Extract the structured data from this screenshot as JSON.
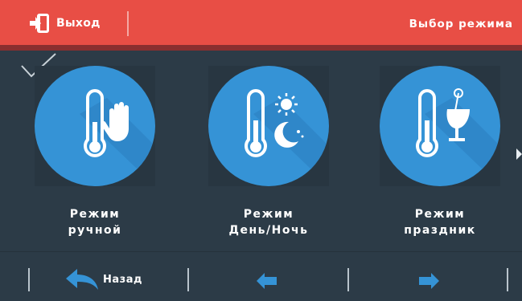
{
  "header": {
    "exit_label": "Выход",
    "title": "Выбор режима"
  },
  "modes": [
    {
      "line1": "Режим",
      "line2": "ручной",
      "icon": "thermometer-hand-icon",
      "selected": true
    },
    {
      "line1": "Режим",
      "line2": "День/Ночь",
      "icon": "thermometer-day-night-icon",
      "selected": false
    },
    {
      "line1": "Режим",
      "line2": "праздник",
      "icon": "thermometer-party-icon",
      "selected": false
    }
  ],
  "footer": {
    "back_label": "Назад"
  },
  "colors": {
    "header": "#e84e45",
    "background": "#2c3b47",
    "circle": "#3593d6"
  }
}
